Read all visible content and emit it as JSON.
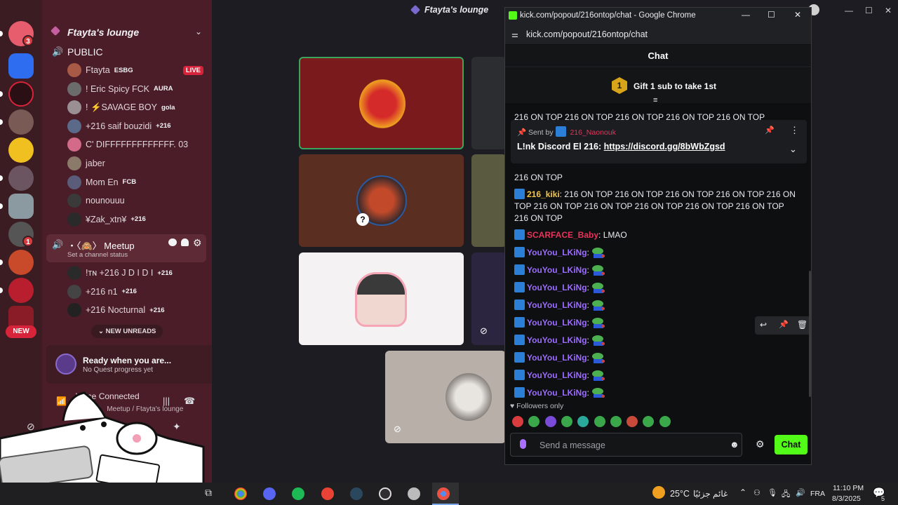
{
  "discord": {
    "server_name": "Ftayta's lounge",
    "stage_title": "Ftayta's lounge",
    "channels": {
      "public": {
        "name": "PUBLIC"
      },
      "meetup": {
        "name": "・〈🙈〉 Meetup",
        "status_placeholder": "Set a channel status"
      }
    },
    "public_members": [
      {
        "name": "Ftayta",
        "tag": "ESBG",
        "live_label": "LIVE",
        "avatar_color": "#a85a46"
      },
      {
        "name": "! Eric Spicy FCK",
        "tag": "AURA",
        "avatar_color": "#6b6b6b"
      },
      {
        "name": "! ⚡SAVAGE BOY",
        "tag": "gola",
        "avatar_color": "#9a8f92"
      },
      {
        "name": "+216 saif bouzidi",
        "tag": "+216",
        "avatar_color": "#5a6a88"
      },
      {
        "name": "C' DIFFFFFFFFFFFFF. 03",
        "tag": "",
        "avatar_color": "#d46a8a"
      },
      {
        "name": "jaber",
        "tag": "",
        "avatar_color": "#8b7a6a"
      },
      {
        "name": "Mom En",
        "tag": "FCB",
        "avatar_color": "#5b5b7a"
      },
      {
        "name": "nounouuu",
        "tag": "",
        "avatar_color": "#3a3a3a"
      },
      {
        "name": "¥Zak_xtn¥",
        "tag": "+216",
        "avatar_color": "#2a2a2a"
      }
    ],
    "meetup_members": [
      {
        "name": "!ᴛɴ +216 J D I D I",
        "tag": "+216",
        "avatar_color": "#2a2a2a"
      },
      {
        "name": "+216 n1",
        "tag": "+216",
        "avatar_color": "#444"
      },
      {
        "name": "+216 Nocturnal",
        "tag": "+216",
        "avatar_color": "#222"
      }
    ],
    "new_unreads_label": "NEW UNREADS",
    "new_badge": "NEW",
    "rail_badges": {
      "first": "3",
      "second": "1"
    },
    "quest": {
      "title": "Ready when you are...",
      "subtitle": "No Quest progress yet"
    },
    "voice": {
      "title": "Voice Connected",
      "subtitle": "・〈🙈〉 Meetup / Ftayta's lounge"
    }
  },
  "chrome": {
    "window_title": "kick.com/popout/216ontop/chat - Google Chrome",
    "url": "kick.com/popout/216ontop/chat"
  },
  "kick_chat": {
    "header_title": "Chat",
    "gift_rank": "1",
    "gift_text": "Gift 1 sub to take 1st",
    "clipped_line": "216 ON TOP 216 ON TOP 216 ON TOP 216 ON TOP 216 ON TOP",
    "pinned": {
      "sent_by_label": "Sent by",
      "sender": "216_Naonouk",
      "text_prefix": "L!nk Discord El 216: ",
      "link": "https://discord.gg/8bWbZgsd"
    },
    "messages": [
      {
        "user": "",
        "text": "216 ON TOP",
        "color": "#e8eaed"
      },
      {
        "user": "216_kiki",
        "text": " 216 ON TOP 216 ON TOP 216 ON TOP 216 ON TOP 216 ON TOP 216 ON TOP 216 ON TOP 216 ON TOP 216 ON TOP 216 ON TOP 216 ON TOP",
        "color": "#f5c542"
      },
      {
        "user": "SCARFACE_Baby",
        "text": " LMAO",
        "color": "#e8335a"
      },
      {
        "user": "YouYou_LKiNg",
        "text": "",
        "color": "#9b6cff"
      },
      {
        "user": "YouYou_LKiNg",
        "text": "",
        "color": "#9b6cff"
      },
      {
        "user": "YouYou_LKiNg",
        "text": "",
        "color": "#9b6cff"
      },
      {
        "user": "YouYou_LKiNg",
        "text": "",
        "color": "#9b6cff"
      },
      {
        "user": "YouYou_LKiNg",
        "text": "",
        "color": "#9b6cff"
      },
      {
        "user": "YouYou_LKiNg",
        "text": "",
        "color": "#9b6cff"
      },
      {
        "user": "YouYou_LKiNg",
        "text": "",
        "color": "#9b6cff"
      },
      {
        "user": "YouYou_LKiNg",
        "text": "",
        "color": "#9b6cff"
      },
      {
        "user": "YouYou_LKiNg",
        "text": "",
        "color": "#9b6cff"
      }
    ],
    "followers_only": "Followers only",
    "input_placeholder": "Send a message",
    "send_button": "Chat",
    "accent": "#53fc18"
  },
  "taskbar": {
    "weather": "25°C",
    "weather_text": "غائم جزئيًا",
    "lang": "FRA",
    "time": "11:10 PM",
    "date": "8/3/2025",
    "notif_count": "5"
  }
}
